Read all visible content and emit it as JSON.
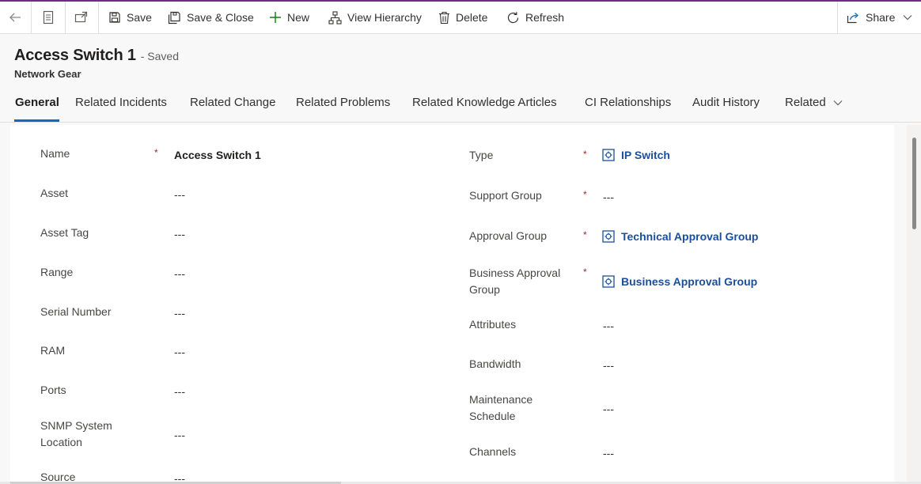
{
  "toolbar": {
    "save": "Save",
    "save_close": "Save & Close",
    "new": "New",
    "view_hierarchy": "View Hierarchy",
    "delete": "Delete",
    "refresh": "Refresh",
    "share": "Share"
  },
  "record": {
    "title": "Access Switch 1",
    "status": "- Saved",
    "entity": "Network Gear"
  },
  "tabs": [
    "General",
    "Related Incidents",
    "Related Change",
    "Related Problems",
    "Related Knowledge Articles",
    "CI Relationships",
    "Audit History",
    "Related"
  ],
  "form": {
    "left": [
      {
        "label": "Name",
        "value": "Access Switch 1",
        "required": "*"
      },
      {
        "label": "Asset",
        "value": "---"
      },
      {
        "label": "Asset Tag",
        "value": "---"
      },
      {
        "label": "Range",
        "value": "---"
      },
      {
        "label": "Serial Number",
        "value": "---"
      },
      {
        "label": "RAM",
        "value": "---"
      },
      {
        "label": "Ports",
        "value": "---"
      },
      {
        "label_line1": "SNMP System",
        "label_line2": "Location",
        "value": "---"
      },
      {
        "label": "Source",
        "value": "---"
      }
    ],
    "right": [
      {
        "label": "Type",
        "value": "IP Switch",
        "required": "*"
      },
      {
        "label": "Support Group",
        "value": "---",
        "required": "*"
      },
      {
        "label": "Approval Group",
        "value": "Technical Approval Group",
        "required": "*"
      },
      {
        "label_line1": "Business Approval",
        "label_line2": "Group",
        "value": "Business Approval Group",
        "required": "*"
      },
      {
        "label": "Attributes",
        "value": "---"
      },
      {
        "label": "Bandwidth",
        "value": "---"
      },
      {
        "label_line1": "Maintenance",
        "label_line2": "Schedule",
        "value": "---"
      },
      {
        "label": "Channels",
        "value": "---"
      }
    ]
  },
  "colors": {
    "accent": "#6b2d8a",
    "tab_underline": "#0f6cbd",
    "lookup_link": "#1a4f9c",
    "required": "#a4262c"
  },
  "icons": [
    "back-arrow-icon",
    "form-icon",
    "open-in-new-window-icon",
    "save-icon",
    "save-close-icon",
    "plus-icon",
    "hierarchy-icon",
    "trash-icon",
    "refresh-icon",
    "share-icon",
    "chevron-down-icon",
    "lookup-record-icon"
  ]
}
